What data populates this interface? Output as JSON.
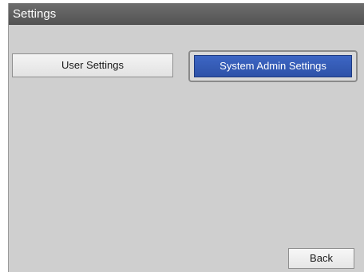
{
  "window": {
    "title": "Settings"
  },
  "buttons": {
    "user_settings": "User Settings",
    "system_admin_settings": "System Admin Settings",
    "back": "Back"
  },
  "colors": {
    "titlebar": "#5f5f5f",
    "background": "#cfcfcf",
    "selected_button": "#3459b6"
  }
}
